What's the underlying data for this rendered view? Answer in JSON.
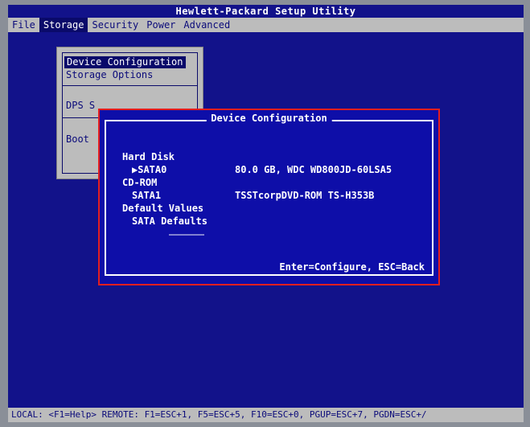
{
  "title": "Hewlett-Packard Setup Utility",
  "menu": [
    {
      "label": "File",
      "active": false
    },
    {
      "label": "Storage",
      "active": true
    },
    {
      "label": "Security",
      "active": false
    },
    {
      "label": "Power",
      "active": false
    },
    {
      "label": "Advanced",
      "active": false
    }
  ],
  "dropdown": {
    "items": [
      "Device Configuration",
      "Storage Options",
      "DPS S",
      "Boot"
    ]
  },
  "dialog": {
    "title": "Device Configuration",
    "rows": [
      {
        "label": "Hard Disk",
        "value": ""
      },
      {
        "label": "▶SATA0",
        "value": "80.0 GB, WDC WD800JD-60LSA5"
      },
      {
        "label": "CD-ROM",
        "value": ""
      },
      {
        "label": "SATA1",
        "value": "TSSTcorpDVD-ROM TS-H353B"
      },
      {
        "label": "Default Values",
        "value": ""
      },
      {
        "label": "SATA Defaults",
        "value": ""
      }
    ],
    "footer": "Enter=Configure, ESC=Back"
  },
  "status": "LOCAL: <F1=Help> REMOTE: F1=ESC+1, F5=ESC+5, F10=ESC+0, PGUP=ESC+7, PGDN=ESC+/",
  "colors": {
    "background": "#12128a",
    "bar": "#bcbcbc",
    "highlight": "#e41e1e"
  }
}
